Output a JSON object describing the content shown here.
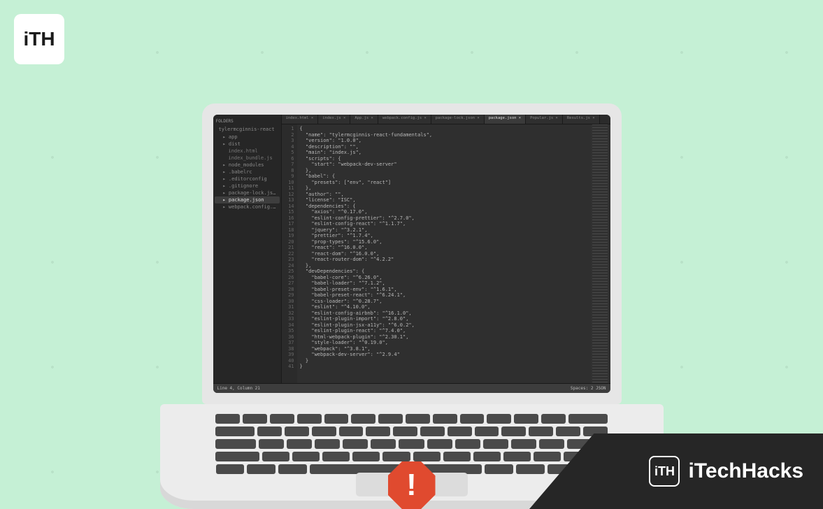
{
  "logo": {
    "text": "iTH"
  },
  "brand": {
    "text": "iTechHacks",
    "badge": "iTH"
  },
  "editor": {
    "sidebar": {
      "header": "FOLDERS",
      "root": "tylermcginnis-react",
      "items": [
        {
          "label": "app",
          "level": 1
        },
        {
          "label": "dist",
          "level": 1
        },
        {
          "label": "index.html",
          "level": 2
        },
        {
          "label": "index_bundle.js",
          "level": 2
        },
        {
          "label": "node_modules",
          "level": 1
        },
        {
          "label": ".babelrc",
          "level": 1
        },
        {
          "label": ".editorconfig",
          "level": 1
        },
        {
          "label": ".gitignore",
          "level": 1
        },
        {
          "label": "package-lock.json",
          "level": 1
        },
        {
          "label": "package.json",
          "level": 1,
          "active": true
        },
        {
          "label": "webpack.config.js",
          "level": 1
        }
      ]
    },
    "tabs": [
      {
        "label": "index.html"
      },
      {
        "label": "index.js"
      },
      {
        "label": "App.js"
      },
      {
        "label": "webpack.config.js"
      },
      {
        "label": "package-lock.json"
      },
      {
        "label": "package.json",
        "active": true
      },
      {
        "label": "Popular.js"
      },
      {
        "label": "Results.js"
      }
    ],
    "code_lines": [
      "{",
      "  \"name\": \"tylermcginnis-react-fundamentals\",",
      "  \"version\": \"1.0.0\",",
      "  \"description\": \"\",",
      "  \"main\": \"index.js\",",
      "  \"scripts\": {",
      "    \"start\": \"webpack-dev-server\"",
      "  },",
      "  \"babel\": {",
      "    \"presets\": [\"env\", \"react\"]",
      "  },",
      "  \"author\": \"\",",
      "  \"license\": \"ISC\",",
      "  \"dependencies\": {",
      "    \"axios\": \"^0.17.0\",",
      "    \"eslint-config-prettier\": \"^2.7.0\",",
      "    \"eslint-config-react\": \"^1.1.7\",",
      "    \"jquery\": \"^3.2.1\",",
      "    \"prettier\": \"^1.7.4\",",
      "    \"prop-types\": \"^15.6.0\",",
      "    \"react\": \"^16.0.0\",",
      "    \"react-dom\": \"^16.0.0\",",
      "    \"react-router-dom\": \"^4.2.2\"",
      "  },",
      "  \"devDependencies\": {",
      "    \"babel-core\": \"^6.26.0\",",
      "    \"babel-loader\": \"^7.1.2\",",
      "    \"babel-preset-env\": \"^1.6.1\",",
      "    \"babel-preset-react\": \"^6.24.1\",",
      "    \"css-loader\": \"^0.28.7\",",
      "    \"eslint\": \"^4.10.0\",",
      "    \"eslint-config-airbnb\": \"^16.1.0\",",
      "    \"eslint-plugin-import\": \"^2.8.0\",",
      "    \"eslint-plugin-jsx-a11y\": \"^6.0.2\",",
      "    \"eslint-plugin-react\": \"^7.4.0\",",
      "    \"html-webpack-plugin\": \"^2.30.1\",",
      "    \"style-loader\": \"^0.19.0\",",
      "    \"webpack\": \"^3.8.1\",",
      "    \"webpack-dev-server\": \"^2.9.4\"",
      "  }",
      "}"
    ],
    "status": {
      "left": "Line 4, Column 21",
      "right": "Spaces: 2     JSON"
    }
  }
}
